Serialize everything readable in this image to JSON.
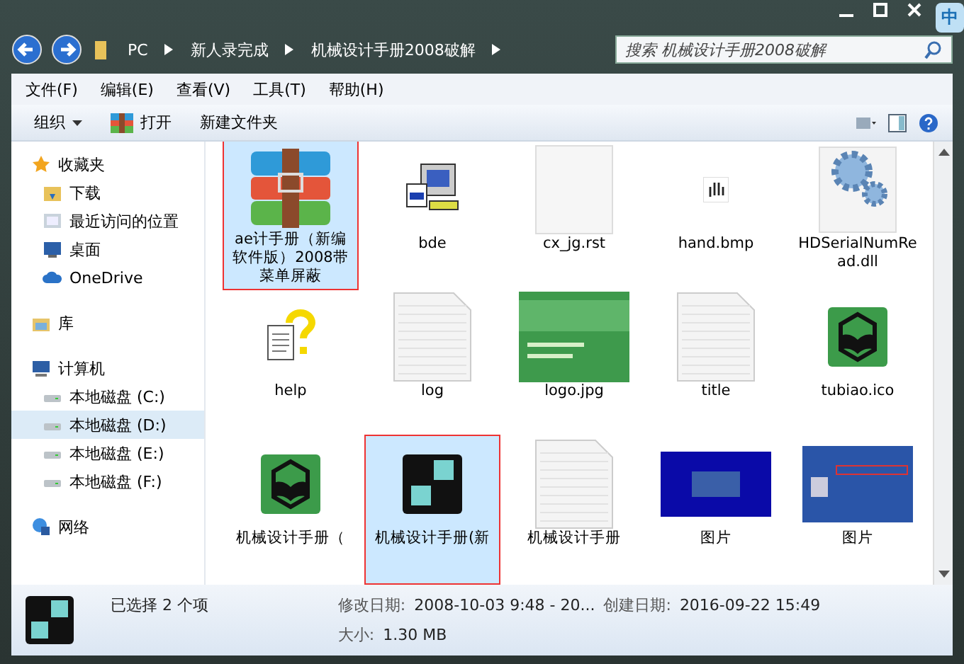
{
  "window": {
    "ime_badge": "中"
  },
  "address": {
    "crumbs": [
      "PC",
      "新人录完成",
      "机械设计手册2008破解"
    ],
    "search_placeholder": "搜索 机械设计手册2008破解"
  },
  "menu": [
    "文件(F)",
    "编辑(E)",
    "查看(V)",
    "工具(T)",
    "帮助(H)"
  ],
  "toolbar": {
    "organize": "组织",
    "open": "打开",
    "new_folder": "新建文件夹"
  },
  "sidebar": [
    {
      "label": "收藏夹",
      "selected": false,
      "children": [
        {
          "label": "下载",
          "selected": false
        },
        {
          "label": "最近访问的位置",
          "selected": false
        },
        {
          "label": "桌面",
          "selected": false
        },
        {
          "label": "OneDrive",
          "selected": false
        }
      ]
    },
    {
      "label": "库",
      "selected": false
    },
    {
      "label": "计算机",
      "selected": false,
      "children": [
        {
          "label": "本地磁盘 (C:)",
          "selected": false
        },
        {
          "label": "本地磁盘 (D:)",
          "selected": true
        },
        {
          "label": "本地磁盘 (E:)",
          "selected": false
        },
        {
          "label": "本地磁盘 (F:)",
          "selected": false
        }
      ]
    },
    {
      "label": "网络",
      "selected": false
    }
  ],
  "files": [
    {
      "label": "ae计手册（新编软件版）2008带菜单屏蔽",
      "kind": "archive",
      "selected": true
    },
    {
      "label": "bde",
      "kind": "program",
      "selected": false
    },
    {
      "label": "cx_jg.rst",
      "kind": "blank",
      "selected": false
    },
    {
      "label": "hand.bmp",
      "kind": "cursor",
      "selected": false
    },
    {
      "label": "HDSerialNumRead.dll",
      "kind": "gear",
      "selected": false
    },
    {
      "label": "help",
      "kind": "help",
      "selected": false
    },
    {
      "label": "log",
      "kind": "text",
      "selected": false
    },
    {
      "label": "logo.jpg",
      "kind": "cover",
      "selected": false
    },
    {
      "label": "title",
      "kind": "text",
      "selected": false
    },
    {
      "label": "tubiao.ico",
      "kind": "book",
      "selected": false
    },
    {
      "label": "机械设计手册（",
      "kind": "book",
      "selected": false
    },
    {
      "label": "机械设计手册(新",
      "kind": "tiles",
      "selected": true
    },
    {
      "label": "机械设计手册",
      "kind": "text",
      "selected": false
    },
    {
      "label": "图片",
      "kind": "screen",
      "selected": false
    },
    {
      "label": "图片",
      "kind": "screen2",
      "selected": false
    }
  ],
  "status": {
    "selection": "已选择 2 个项",
    "modified_label": "修改日期:",
    "modified": "2008-10-03 9:48 - 20...",
    "created_label": "创建日期:",
    "created": "2016-09-22 15:49",
    "size_label": "大小:",
    "size": "1.30 MB"
  }
}
